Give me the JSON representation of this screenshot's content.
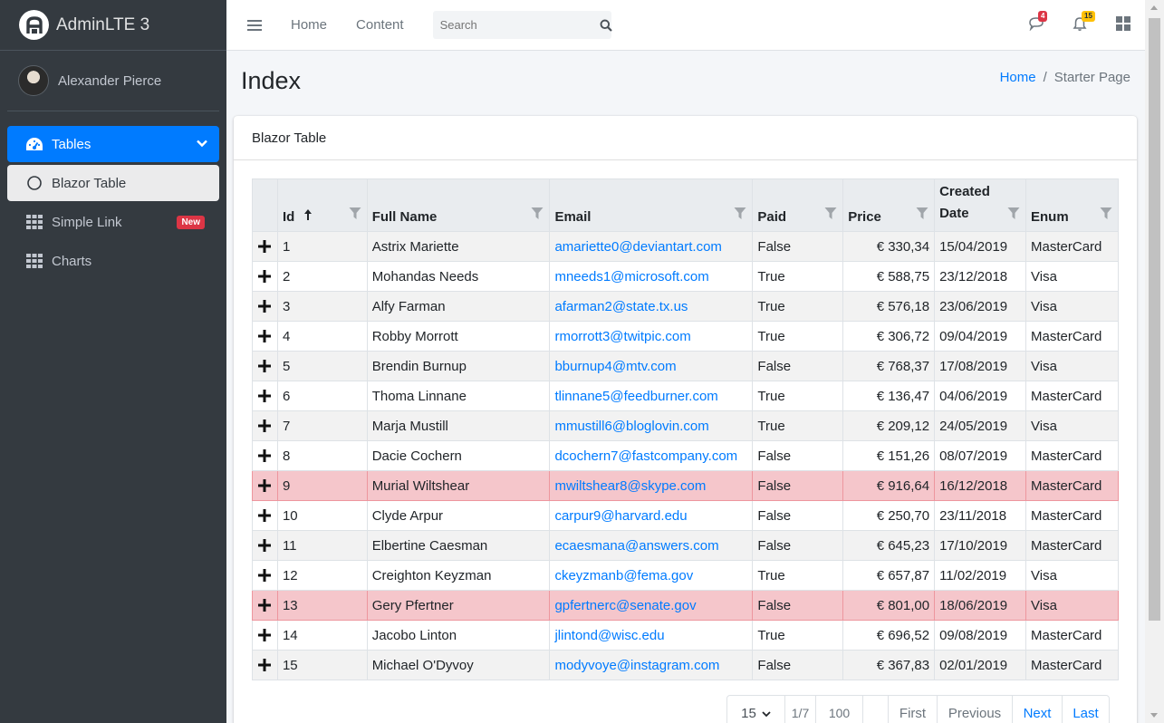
{
  "brand": {
    "name": "AdminLTE 3"
  },
  "user": {
    "name": "Alexander Pierce"
  },
  "sidebar": {
    "items": [
      {
        "label": "Tables",
        "icon": "tachometer-icon"
      },
      {
        "label": "Blazor Table",
        "icon": "circle-icon"
      },
      {
        "label": "Simple Link",
        "icon": "grid-icon",
        "badge": "New"
      },
      {
        "label": "Charts",
        "icon": "grid-icon"
      }
    ]
  },
  "topbar": {
    "links": [
      "Home",
      "Content"
    ],
    "search_placeholder": "Search",
    "messages_count": "4",
    "notifications_count": "15"
  },
  "header": {
    "title": "Index",
    "breadcrumb": [
      "Home",
      "Starter Page"
    ]
  },
  "card": {
    "title": "Blazor Table"
  },
  "table": {
    "columns": [
      "Id",
      "Full Name",
      "Email",
      "Paid",
      "Price",
      "Created Date",
      "Enum"
    ],
    "sorted_column": "Id",
    "rows": [
      {
        "id": "1",
        "name": "Astrix Mariette",
        "email": "amariette0@deviantart.com",
        "paid": "False",
        "price": "€ 330,34",
        "date": "15/04/2019",
        "enum": "MasterCard",
        "danger": false
      },
      {
        "id": "2",
        "name": "Mohandas Needs",
        "email": "mneeds1@microsoft.com",
        "paid": "True",
        "price": "€ 588,75",
        "date": "23/12/2018",
        "enum": "Visa",
        "danger": false
      },
      {
        "id": "3",
        "name": "Alfy Farman",
        "email": "afarman2@state.tx.us",
        "paid": "True",
        "price": "€ 576,18",
        "date": "23/06/2019",
        "enum": "Visa",
        "danger": false
      },
      {
        "id": "4",
        "name": "Robby Morrott",
        "email": "rmorrott3@twitpic.com",
        "paid": "True",
        "price": "€ 306,72",
        "date": "09/04/2019",
        "enum": "MasterCard",
        "danger": false
      },
      {
        "id": "5",
        "name": "Brendin Burnup",
        "email": "bburnup4@mtv.com",
        "paid": "False",
        "price": "€ 768,37",
        "date": "17/08/2019",
        "enum": "Visa",
        "danger": false
      },
      {
        "id": "6",
        "name": "Thoma Linnane",
        "email": "tlinnane5@feedburner.com",
        "paid": "True",
        "price": "€ 136,47",
        "date": "04/06/2019",
        "enum": "MasterCard",
        "danger": false
      },
      {
        "id": "7",
        "name": "Marja Mustill",
        "email": "mmustill6@bloglovin.com",
        "paid": "True",
        "price": "€ 209,12",
        "date": "24/05/2019",
        "enum": "Visa",
        "danger": false
      },
      {
        "id": "8",
        "name": "Dacie Cochern",
        "email": "dcochern7@fastcompany.com",
        "paid": "False",
        "price": "€ 151,26",
        "date": "08/07/2019",
        "enum": "MasterCard",
        "danger": false
      },
      {
        "id": "9",
        "name": "Murial Wiltshear",
        "email": "mwiltshear8@skype.com",
        "paid": "False",
        "price": "€ 916,64",
        "date": "16/12/2018",
        "enum": "MasterCard",
        "danger": true
      },
      {
        "id": "10",
        "name": "Clyde Arpur",
        "email": "carpur9@harvard.edu",
        "paid": "False",
        "price": "€ 250,70",
        "date": "23/11/2018",
        "enum": "MasterCard",
        "danger": false
      },
      {
        "id": "11",
        "name": "Elbertine Caesman",
        "email": "ecaesmana@answers.com",
        "paid": "False",
        "price": "€ 645,23",
        "date": "17/10/2019",
        "enum": "MasterCard",
        "danger": false
      },
      {
        "id": "12",
        "name": "Creighton Keyzman",
        "email": "ckeyzmanb@fema.gov",
        "paid": "True",
        "price": "€ 657,87",
        "date": "11/02/2019",
        "enum": "Visa",
        "danger": false
      },
      {
        "id": "13",
        "name": "Gery Pfertner",
        "email": "gpfertnerc@senate.gov",
        "paid": "False",
        "price": "€ 801,00",
        "date": "18/06/2019",
        "enum": "Visa",
        "danger": true
      },
      {
        "id": "14",
        "name": "Jacobo Linton",
        "email": "jlintond@wisc.edu",
        "paid": "True",
        "price": "€ 696,52",
        "date": "09/08/2019",
        "enum": "MasterCard",
        "danger": false
      },
      {
        "id": "15",
        "name": "Michael O'Dyvoy",
        "email": "modyvoye@instagram.com",
        "paid": "False",
        "price": "€ 367,83",
        "date": "02/01/2019",
        "enum": "MasterCard",
        "danger": false
      }
    ]
  },
  "pager": {
    "page_size": "15",
    "page_info": "1/7",
    "total": "100",
    "first": "First",
    "previous": "Previous",
    "next": "Next",
    "last": "Last"
  },
  "colors": {
    "primary": "#007bff",
    "danger_row": "#f5c6cb",
    "sidebar": "#343a40"
  }
}
